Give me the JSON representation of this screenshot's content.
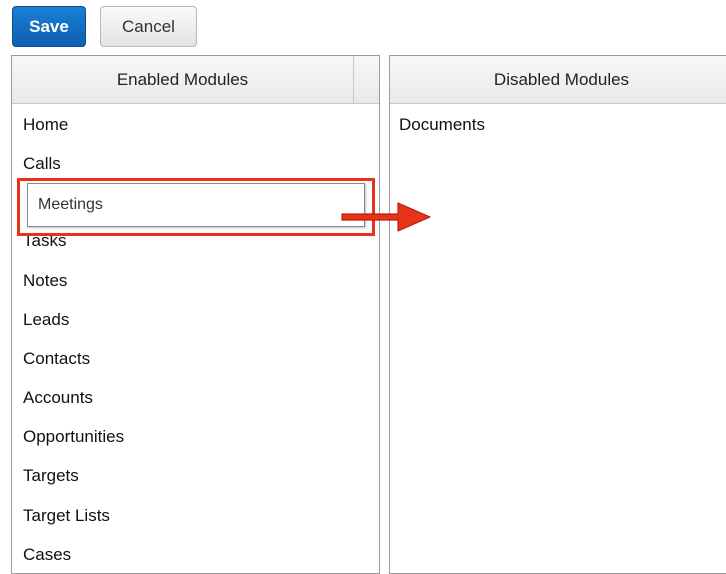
{
  "toolbar": {
    "save_label": "Save",
    "cancel_label": "Cancel"
  },
  "enabled_panel": {
    "header": "Enabled Modules",
    "items": [
      "Home",
      "Calls",
      "Tasks",
      "Notes",
      "Leads",
      "Contacts",
      "Accounts",
      "Opportunities",
      "Targets",
      "Target Lists",
      "Cases"
    ]
  },
  "dragged_item": {
    "label": "Meetings"
  },
  "disabled_panel": {
    "header": "Disabled Modules",
    "items": [
      "Documents"
    ]
  },
  "colors": {
    "save_button": "#1a7fd6",
    "highlight": "#e8321a",
    "arrow": "#e8321a"
  },
  "icons": {
    "drag_arrow": "right-arrow-icon"
  }
}
